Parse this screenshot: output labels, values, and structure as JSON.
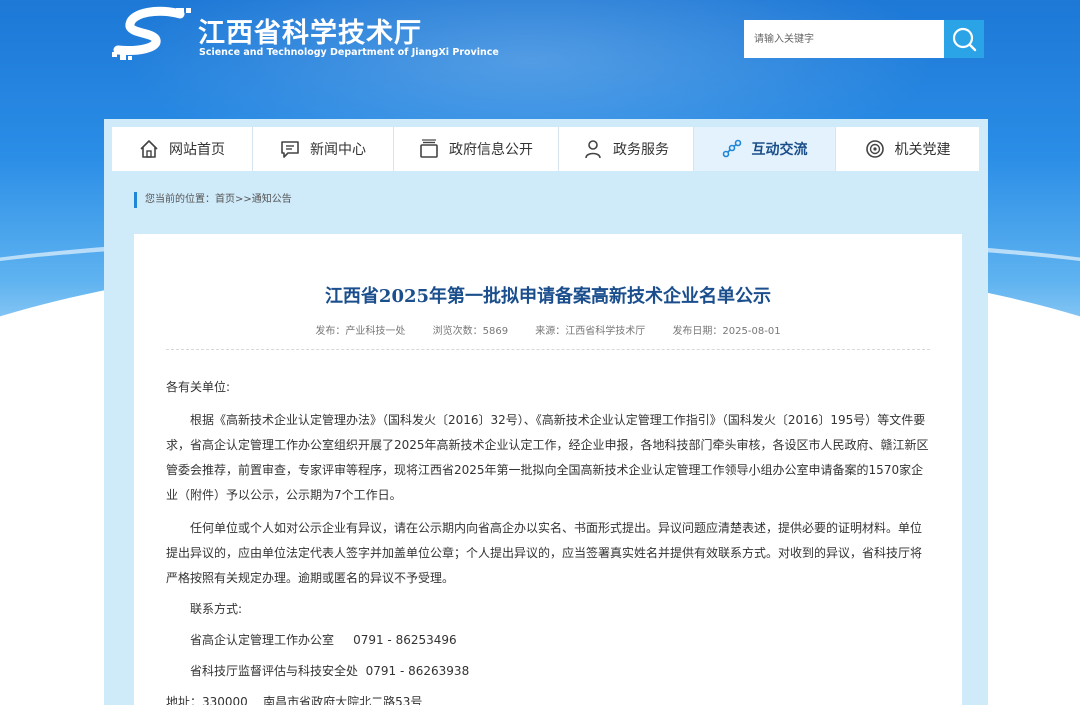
{
  "header": {
    "title": "江西省科学技术厅",
    "subtitle": "Science and Technology Department of JiangXi Province",
    "search_placeholder": "请输入关键字"
  },
  "nav": {
    "items": [
      {
        "label": "网站首页",
        "icon": "home-icon"
      },
      {
        "label": "新闻中心",
        "icon": "chat-icon"
      },
      {
        "label": "政府信息公开",
        "icon": "folder-icon"
      },
      {
        "label": "政务服务",
        "icon": "user-icon"
      },
      {
        "label": "互动交流",
        "icon": "connect-icon",
        "active": true
      },
      {
        "label": "机关党建",
        "icon": "badge-icon"
      }
    ]
  },
  "breadcrumb": {
    "prefix": "您当前的位置：",
    "home": "首页",
    "sep": ">>",
    "current": "通知公告"
  },
  "article": {
    "title": "江西省2025年第一批拟申请备案高新技术企业名单公示",
    "meta": {
      "publisher": "发布：产业科技一处",
      "views": "浏览次数：5869",
      "source": "来源：江西省科学技术厅",
      "date": "发布日期：2025-08-01"
    },
    "salutation": "各有关单位:",
    "para1": "根据《高新技术企业认定管理办法》（国科发火〔2016〕32号）、《高新技术企业认定管理工作指引》（国科发火〔2016〕195号）等文件要求，省高企认定管理工作办公室组织开展了2025年高新技术企业认定工作，经企业申报，各地科技部门牵头审核，各设区市人民政府、赣江新区管委会推荐，前置审查，专家评审等程序，现将江西省2025年第一批拟向全国高新技术企业认定管理工作领导小组办公室申请备案的1570家企业（附件）予以公示，公示期为7个工作日。",
    "para2": "任何单位或个人如对公示企业有异议，请在公示期内向省高企办以实名、书面形式提出。异议问题应清楚表述，提供必要的证明材料。单位提出异议的，应由单位法定代表人签字并加盖单位公章；个人提出异议的，应当签署真实姓名并提供有效联系方式。对收到的异议，省科技厅将严格按照有关规定办理。逾期或匿名的异议不予受理。",
    "contact_label": "联系方式:",
    "contact1": "省高企认定管理工作办公室     0791 - 86253496",
    "contact2": "省科技厅监督评估与科技安全处  0791 - 86263938",
    "address": "地址：330000    南昌市省政府大院北二路53号"
  },
  "colors": {
    "brand_blue": "#1f86d8",
    "title_blue": "#1b4e8c",
    "search_button": "#2aa4e6",
    "nav_active_bg": "#e3f2fc"
  }
}
